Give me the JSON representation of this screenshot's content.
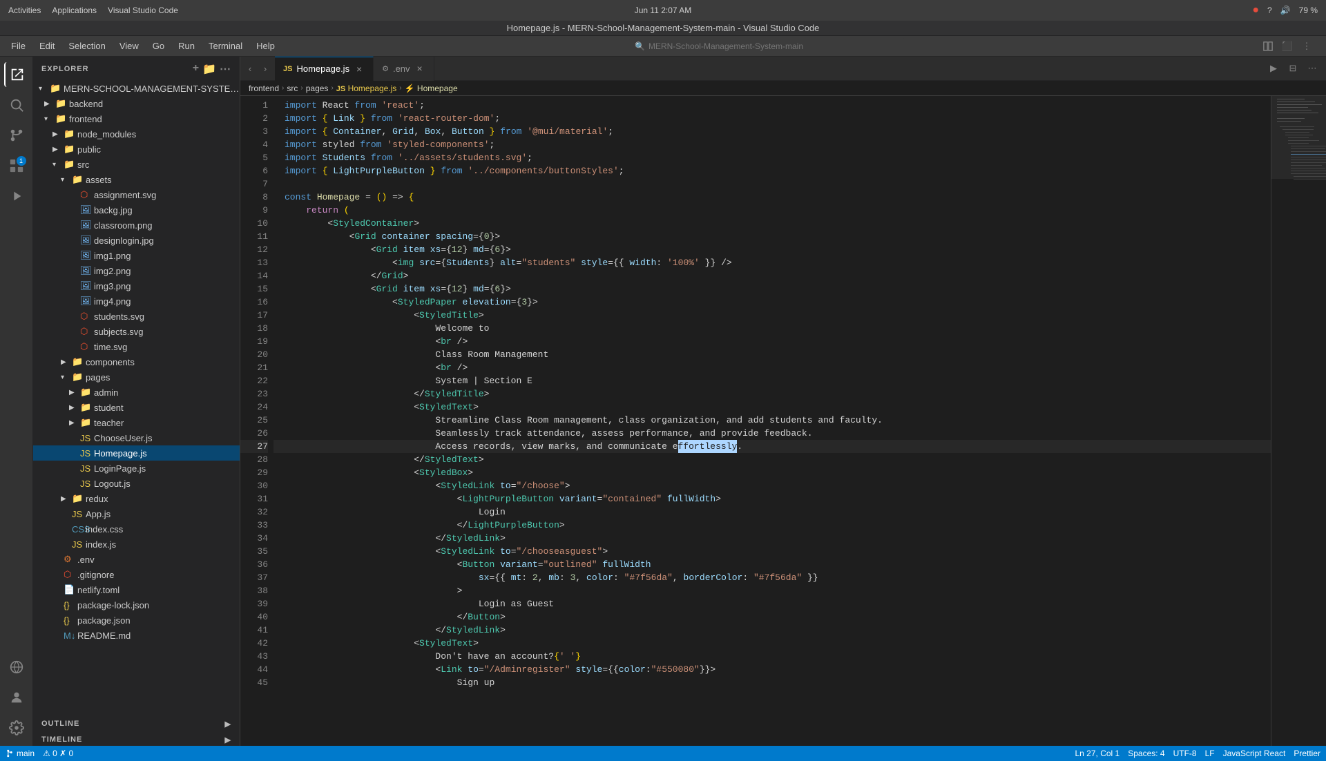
{
  "window": {
    "title": "Homepage.js - MERN-School-Management-System-main - Visual Studio Code"
  },
  "topbar": {
    "datetime": "Jun 11  2:07 AM",
    "app_left": "Activities",
    "app_mid": "Applications",
    "vscode_label": "Visual Studio Code"
  },
  "menubar": {
    "items": [
      "File",
      "Edit",
      "Selection",
      "View",
      "Go",
      "Run",
      "Terminal",
      "Help"
    ]
  },
  "search": {
    "placeholder": "MERN-School-Management-System-main"
  },
  "sidebar": {
    "title": "EXPLORER",
    "root": "MERN-SCHOOL-MANAGEMENT-SYSTEM-MAIN",
    "items": [
      {
        "label": "backend",
        "type": "folder",
        "indent": 1,
        "open": false
      },
      {
        "label": "frontend",
        "type": "folder",
        "indent": 1,
        "open": true
      },
      {
        "label": "node_modules",
        "type": "folder",
        "indent": 2,
        "open": false
      },
      {
        "label": "public",
        "type": "folder",
        "indent": 2,
        "open": false
      },
      {
        "label": "src",
        "type": "folder",
        "indent": 2,
        "open": true
      },
      {
        "label": "assets",
        "type": "folder",
        "indent": 3,
        "open": true
      },
      {
        "label": "assignment.svg",
        "type": "svg",
        "indent": 4
      },
      {
        "label": "backg.jpg",
        "type": "img",
        "indent": 4
      },
      {
        "label": "classroom.png",
        "type": "img",
        "indent": 4
      },
      {
        "label": "designlogin.jpg",
        "type": "img",
        "indent": 4
      },
      {
        "label": "img1.png",
        "type": "img",
        "indent": 4
      },
      {
        "label": "img2.png",
        "type": "img",
        "indent": 4
      },
      {
        "label": "img3.png",
        "type": "img",
        "indent": 4
      },
      {
        "label": "img4.png",
        "type": "img",
        "indent": 4
      },
      {
        "label": "students.svg",
        "type": "svg",
        "indent": 4
      },
      {
        "label": "subjects.svg",
        "type": "svg",
        "indent": 4
      },
      {
        "label": "time.svg",
        "type": "svg",
        "indent": 4
      },
      {
        "label": "components",
        "type": "folder",
        "indent": 3,
        "open": false
      },
      {
        "label": "pages",
        "type": "folder",
        "indent": 3,
        "open": true
      },
      {
        "label": "admin",
        "type": "folder",
        "indent": 4,
        "open": false
      },
      {
        "label": "student",
        "type": "folder",
        "indent": 4,
        "open": false
      },
      {
        "label": "teacher",
        "type": "folder",
        "indent": 4,
        "open": false
      },
      {
        "label": "ChooseUser.js",
        "type": "js",
        "indent": 4
      },
      {
        "label": "Homepage.js",
        "type": "js",
        "indent": 4,
        "selected": true
      },
      {
        "label": "LoginPage.js",
        "type": "js",
        "indent": 4
      },
      {
        "label": "Logout.js",
        "type": "js",
        "indent": 4
      },
      {
        "label": "redux",
        "type": "folder",
        "indent": 3,
        "open": false
      },
      {
        "label": "App.js",
        "type": "js",
        "indent": 3
      },
      {
        "label": "index.css",
        "type": "css",
        "indent": 3
      },
      {
        "label": "index.js",
        "type": "js",
        "indent": 3
      },
      {
        "label": ".env",
        "type": "env",
        "indent": 2
      },
      {
        "label": ".gitignore",
        "type": "git",
        "indent": 2
      },
      {
        "label": "netlify.toml",
        "type": "toml",
        "indent": 2
      },
      {
        "label": "package-lock.json",
        "type": "json",
        "indent": 2
      },
      {
        "label": "package.json",
        "type": "json",
        "indent": 2
      },
      {
        "label": "README.md",
        "type": "md",
        "indent": 2
      }
    ],
    "bottom": [
      {
        "label": "OUTLINE",
        "open": false
      },
      {
        "label": "TIMELINE",
        "open": false
      }
    ]
  },
  "tabs": [
    {
      "label": "Homepage.js",
      "type": "js",
      "active": true
    },
    {
      "label": ".env",
      "type": "env",
      "active": false
    }
  ],
  "breadcrumb": {
    "items": [
      "frontend",
      "src",
      "pages",
      "Homepage.js",
      "Homepage"
    ]
  },
  "code": {
    "lines": [
      {
        "num": 1,
        "content": "import React from 'react';"
      },
      {
        "num": 2,
        "content": "import { Link } from 'react-router-dom';"
      },
      {
        "num": 3,
        "content": "import { Container, Grid, Box, Button } from '@mui/material';"
      },
      {
        "num": 4,
        "content": "import styled from 'styled-components';"
      },
      {
        "num": 5,
        "content": "import Students from '../assets/students.svg';"
      },
      {
        "num": 6,
        "content": "import { LightPurpleButton } from '../components/buttonStyles';"
      },
      {
        "num": 7,
        "content": ""
      },
      {
        "num": 8,
        "content": "const Homepage = () => {"
      },
      {
        "num": 9,
        "content": "    return ("
      },
      {
        "num": 10,
        "content": "        <StyledContainer>"
      },
      {
        "num": 11,
        "content": "            <Grid container spacing={0}>"
      },
      {
        "num": 12,
        "content": "                <Grid item xs={12} md={6}>"
      },
      {
        "num": 13,
        "content": "                    <img src={Students} alt=\"students\" style={{ width: '100%' }} />"
      },
      {
        "num": 14,
        "content": "                </Grid>"
      },
      {
        "num": 15,
        "content": "                <Grid item xs={12} md={6}>"
      },
      {
        "num": 16,
        "content": "                    <StyledPaper elevation={3}>"
      },
      {
        "num": 17,
        "content": "                        <StyledTitle>"
      },
      {
        "num": 18,
        "content": "                            Welcome to"
      },
      {
        "num": 19,
        "content": "                            <br />"
      },
      {
        "num": 20,
        "content": "                            Class Room Management"
      },
      {
        "num": 21,
        "content": "                            <br />"
      },
      {
        "num": 22,
        "content": "                            System | Section E"
      },
      {
        "num": 23,
        "content": "                        </StyledTitle>"
      },
      {
        "num": 24,
        "content": "                        <StyledText>"
      },
      {
        "num": 25,
        "content": "                            Streamline Class Room management, class organization, and add students and faculty."
      },
      {
        "num": 26,
        "content": "                            Seamlessly track attendance, assess performance, and provide feedback."
      },
      {
        "num": 27,
        "content": "                            Access records, view marks, and communicate effortlessly."
      },
      {
        "num": 28,
        "content": "                        </StyledText>"
      },
      {
        "num": 29,
        "content": "                        <StyledBox>"
      },
      {
        "num": 30,
        "content": "                            <StyledLink to=\"/choose\">"
      },
      {
        "num": 31,
        "content": "                                <LightPurpleButton variant=\"contained\" fullWidth>"
      },
      {
        "num": 32,
        "content": "                                    Login"
      },
      {
        "num": 33,
        "content": "                                </LightPurpleButton>"
      },
      {
        "num": 34,
        "content": "                            </StyledLink>"
      },
      {
        "num": 35,
        "content": "                            <StyledLink to=\"/chooseasguest\">"
      },
      {
        "num": 36,
        "content": "                                <Button variant=\"outlined\" fullWidth"
      },
      {
        "num": 37,
        "content": "                                    sx={{ mt: 2, mb: 3, color: \"#7f56da\", borderColor: \"#7f56da\" }}"
      },
      {
        "num": 38,
        "content": "                                >"
      },
      {
        "num": 39,
        "content": "                                    Login as Guest"
      },
      {
        "num": 40,
        "content": "                                </Button>"
      },
      {
        "num": 41,
        "content": "                            </StyledLink>"
      },
      {
        "num": 42,
        "content": "                        <StyledText>"
      },
      {
        "num": 43,
        "content": "                            Don't have an account?{' '}"
      },
      {
        "num": 44,
        "content": "                            <Link to=\"/Adminregister\" style={{color:\"#550080\"}}>"
      },
      {
        "num": 45,
        "content": "                                Sign up"
      }
    ]
  },
  "statusbar": {
    "left": [
      "⎇ main",
      "0 ⚠ 0 ✗"
    ],
    "right": [
      "Ln 27, Col 1",
      "Spaces: 4",
      "UTF-8",
      "LF",
      "JavaScript React",
      "Prettier"
    ]
  }
}
